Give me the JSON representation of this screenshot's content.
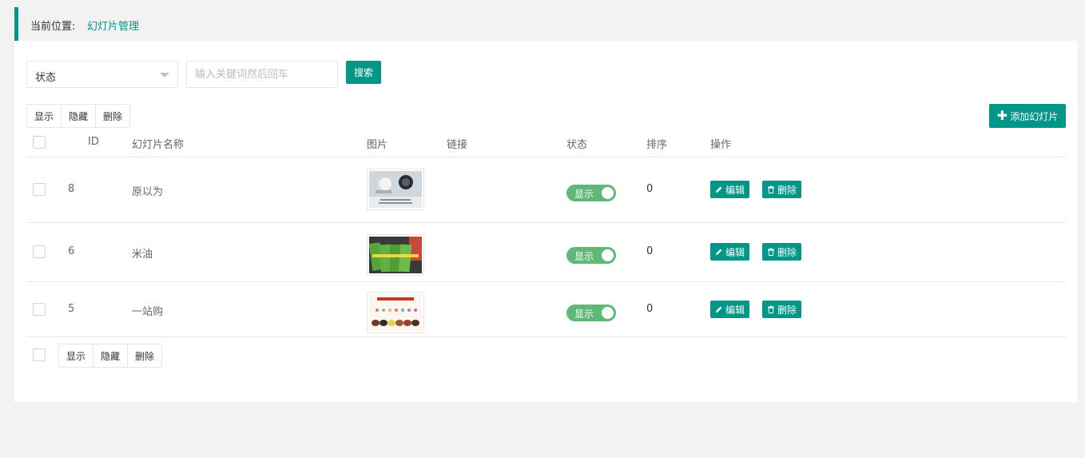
{
  "breadcrumb": {
    "prefix": "当前位置:",
    "current": "幻灯片管理"
  },
  "filters": {
    "status_select": {
      "value": "状态"
    },
    "keyword": {
      "placeholder": "输入关键词然后回车"
    },
    "search_label": "搜索"
  },
  "toolbar": {
    "show_label": "显示",
    "hide_label": "隐藏",
    "delete_label": "删除",
    "add_label": "添加幻灯片"
  },
  "table": {
    "headers": {
      "id": "ID",
      "name": "幻灯片名称",
      "image": "图片",
      "link": "链接",
      "status": "状态",
      "sort": "排序",
      "ops": "操作"
    },
    "rows": [
      {
        "id": "8",
        "name": "原以为",
        "link": "",
        "status": "显示",
        "sort": "0",
        "edit": "编辑",
        "delete": "删除"
      },
      {
        "id": "6",
        "name": "米油",
        "link": "",
        "status": "显示",
        "sort": "0",
        "edit": "编辑",
        "delete": "删除"
      },
      {
        "id": "5",
        "name": "一站购",
        "link": "",
        "status": "显示",
        "sort": "0",
        "edit": "编辑",
        "delete": "删除"
      }
    ]
  },
  "bottom_toolbar": {
    "show_label": "显示",
    "hide_label": "隐藏",
    "delete_label": "删除"
  },
  "colors": {
    "accent": "#009688",
    "switch_on": "#5fb878"
  },
  "icons": [
    "plus-icon",
    "pencil-icon",
    "trash-icon",
    "chevron-down-icon"
  ]
}
